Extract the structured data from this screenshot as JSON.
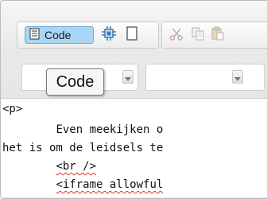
{
  "toolbar": {
    "code_button_label": "Code",
    "icons": [
      "source-icon",
      "plugin-icon",
      "blank-page-icon",
      "cut-icon",
      "copy-icon",
      "paste-icon"
    ]
  },
  "dropdowns": [
    {
      "value": ""
    },
    {
      "value": ""
    }
  ],
  "tooltip": {
    "text": "Code"
  },
  "source": {
    "line1": "<p>",
    "line2_text": "Even meekijken o",
    "line3_text": "het is om de leidsels te",
    "line4_text": "<br />",
    "line5_text": "<iframe allowful"
  },
  "colors": {
    "active_button": "#a9d6f5",
    "active_border": "#6ba9d8",
    "spellcheck": "#d9352b"
  }
}
